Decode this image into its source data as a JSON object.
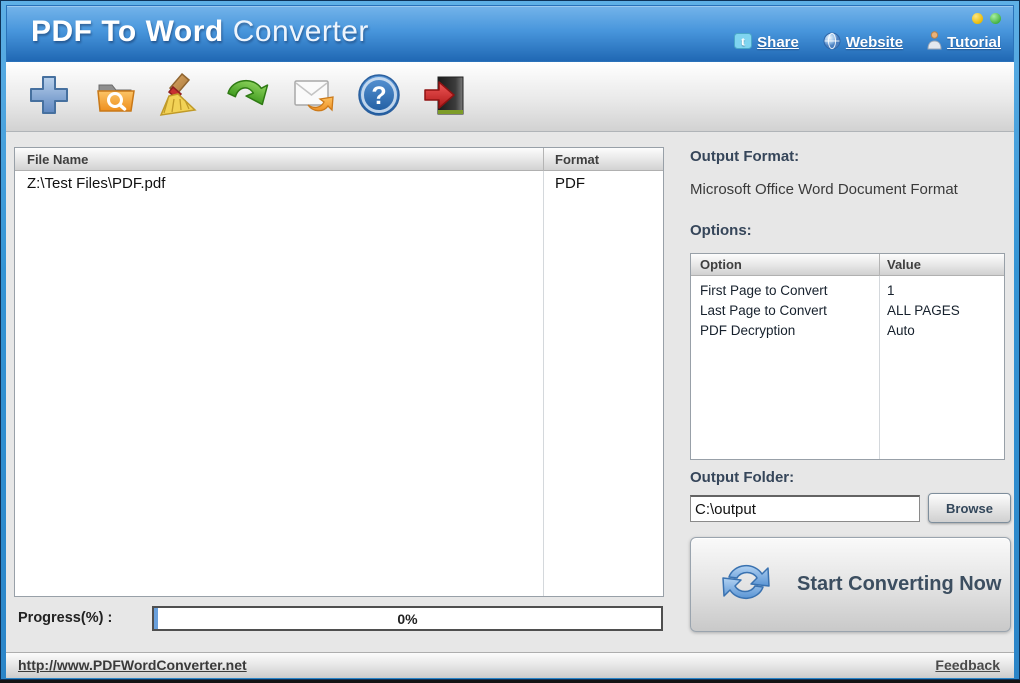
{
  "titlebar": {
    "title_primary": "PDF To Word",
    "title_secondary": "Converter",
    "links": [
      {
        "label": "Share",
        "icon": "twitter-icon"
      },
      {
        "label": "Website",
        "icon": "globe-icon"
      },
      {
        "label": "Tutorial",
        "icon": "person-icon"
      }
    ],
    "controls": [
      {
        "name": "minimize",
        "icon": "yellow-dot-icon"
      },
      {
        "name": "close",
        "icon": "green-dot-icon"
      }
    ]
  },
  "toolbar": {
    "buttons": [
      {
        "name": "add-files",
        "icon": "plus-icon"
      },
      {
        "name": "browse-files",
        "icon": "folder-search-icon"
      },
      {
        "name": "clear-list",
        "icon": "broom-icon"
      },
      {
        "name": "convert",
        "icon": "green-arrow-icon"
      },
      {
        "name": "send-email",
        "icon": "mail-forward-icon"
      },
      {
        "name": "help",
        "icon": "question-icon"
      },
      {
        "name": "exit",
        "icon": "exit-door-icon"
      }
    ]
  },
  "file_list": {
    "columns": [
      "File Name",
      "Format"
    ],
    "rows": [
      {
        "file_name": "Z:\\Test Files\\PDF.pdf",
        "format": "PDF"
      }
    ]
  },
  "output_format": {
    "label": "Output Format:",
    "value": "Microsoft Office Word Document Format"
  },
  "options": {
    "label": "Options:",
    "columns": [
      "Option",
      "Value"
    ],
    "rows": [
      {
        "option": "First Page to Convert",
        "value": "1"
      },
      {
        "option": "Last Page to Convert",
        "value": "ALL PAGES"
      },
      {
        "option": "PDF Decryption",
        "value": "Auto"
      }
    ]
  },
  "output_folder": {
    "label": "Output Folder:",
    "value": "C:\\output",
    "browse_label": "Browse"
  },
  "convert": {
    "label": "Start Converting Now",
    "icon": "sync-arrows-icon"
  },
  "progress": {
    "label": "Progress(%) :",
    "value": "0%",
    "percent": 0
  },
  "footer": {
    "url": "http://www.PDFWordConverter.net",
    "feedback_label": "Feedback"
  },
  "colors": {
    "frame_blue": "#3494d4",
    "titlebar_top": "#74b4ea",
    "titlebar_bottom": "#2068b4",
    "folder_orange": "#f5a23c",
    "arrow_green": "#5cb832",
    "exit_red": "#d42020",
    "help_blue": "#2a6fc0"
  }
}
